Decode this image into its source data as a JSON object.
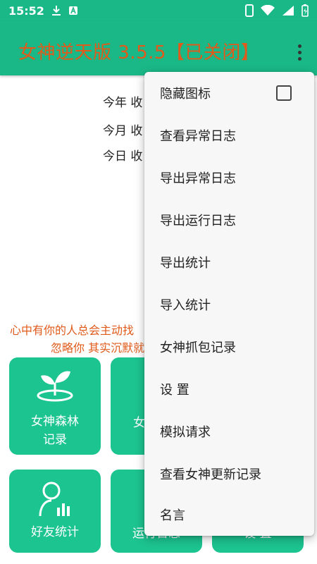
{
  "status_bar": {
    "time": "15:52"
  },
  "app_bar": {
    "title": "女神逆天版 3.5.5【已关闭】"
  },
  "stats": [
    {
      "label": "今年  收"
    },
    {
      "label": "今月  收"
    },
    {
      "label": "今日  收"
    }
  ],
  "quote": {
    "line1": "心中有你的人总会主动找",
    "line2": "忽略你  其实沉默就"
  },
  "tiles": [
    {
      "label1": "女神森林",
      "label2": "记录"
    },
    {
      "label1": "女"
    },
    {
      "label1": "好友统计"
    },
    {
      "label1": "运行日志"
    },
    {
      "label1": "设 置"
    }
  ],
  "menu": {
    "items": [
      {
        "label": "隐藏图标",
        "checked": false
      },
      {
        "label": "查看异常日志"
      },
      {
        "label": "导出异常日志"
      },
      {
        "label": "导出运行日志"
      },
      {
        "label": "导出统计"
      },
      {
        "label": "导入统计"
      },
      {
        "label": "女神抓包记录"
      },
      {
        "label": "设  置"
      },
      {
        "label": "模拟请求"
      },
      {
        "label": "查看女神更新记录"
      },
      {
        "label": "名言"
      }
    ]
  },
  "colors": {
    "primary": "#1ab886",
    "tile": "#1cc48f",
    "accent": "#e05a1b"
  }
}
